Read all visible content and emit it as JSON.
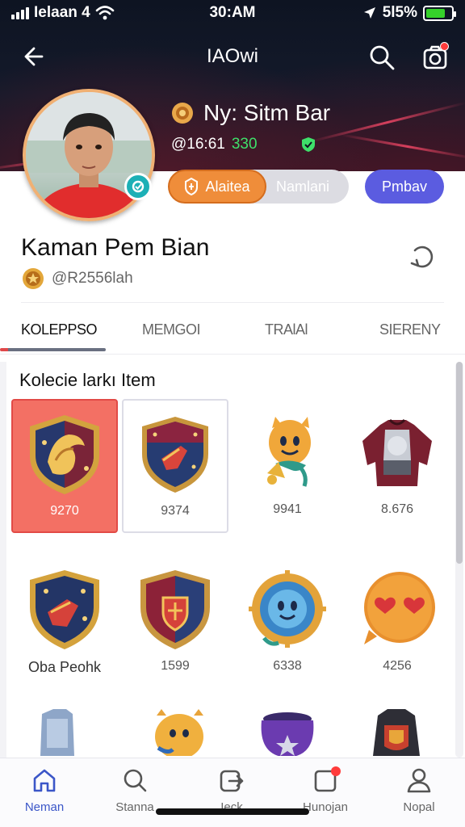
{
  "status_bar": {
    "carrier": "Ielaan 4",
    "time": "30:AM",
    "battery": "5l5%"
  },
  "header": {
    "title": "IAOwi"
  },
  "hero": {
    "name": "Ny: Sitm Bar",
    "stat_id": "@16:61",
    "stat_value": "330",
    "buttons": {
      "orange": "Alaitea",
      "gray": "Namlani",
      "blue": "Pmbav"
    }
  },
  "profile": {
    "name": "Kaman Pem Bian",
    "handle": "@R2556lah"
  },
  "tabs": [
    {
      "label": "KOLEPPSO",
      "active": true
    },
    {
      "label": "MEMGOI",
      "active": false
    },
    {
      "label": "TRAlAl",
      "active": false
    },
    {
      "label": "SIERENY",
      "active": false
    }
  ],
  "collection": {
    "title": "Kolecie larkı Item",
    "items": [
      {
        "name": "crest-shield-gold",
        "price": "9270",
        "selected": true
      },
      {
        "name": "blue-shield-emblem",
        "price": "9374",
        "outlined": true
      },
      {
        "name": "bell-mascot",
        "price": "9941"
      },
      {
        "name": "armor-jacket",
        "price": "8.676"
      },
      {
        "name": "gold-shield-red-banner",
        "price": "Oba Peohk"
      },
      {
        "name": "red-blue-shield",
        "price": "1599"
      },
      {
        "name": "sun-medal",
        "price": "6338"
      },
      {
        "name": "heart-eyes-emoji",
        "price": "4256"
      }
    ]
  },
  "bottom_nav": [
    {
      "label": "Neman",
      "icon": "home-icon",
      "active": true
    },
    {
      "label": "Stanna",
      "icon": "search-icon",
      "active": false
    },
    {
      "label": "Ieck",
      "icon": "share-icon",
      "active": false
    },
    {
      "label": "Hunojan",
      "icon": "notification-icon",
      "active": false
    },
    {
      "label": "Nopal",
      "icon": "profile-icon",
      "active": false
    }
  ],
  "colors": {
    "orange": "#ef8d3a",
    "blue": "#5b5ce0",
    "selected": "#f37064",
    "accent_green": "#3ee06a",
    "active_nav": "#3b56c8"
  }
}
